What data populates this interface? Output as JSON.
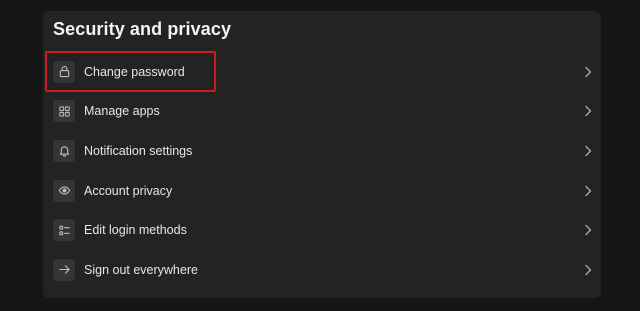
{
  "section": {
    "title": "Security and privacy"
  },
  "items": [
    {
      "label": "Change password",
      "icon": "lock-icon"
    },
    {
      "label": "Manage apps",
      "icon": "apps-grid-icon"
    },
    {
      "label": "Notification settings",
      "icon": "bell-icon"
    },
    {
      "label": "Account privacy",
      "icon": "eye-icon"
    },
    {
      "label": "Edit login methods",
      "icon": "list-icon"
    },
    {
      "label": "Sign out everywhere",
      "icon": "arrow-right-icon"
    }
  ],
  "highlight": {
    "target": "Change password",
    "color": "#d01a1f"
  },
  "colors": {
    "background": "#151515",
    "panel": "#232323",
    "icon_tile": "#353535",
    "text": "#e6e6e6"
  }
}
